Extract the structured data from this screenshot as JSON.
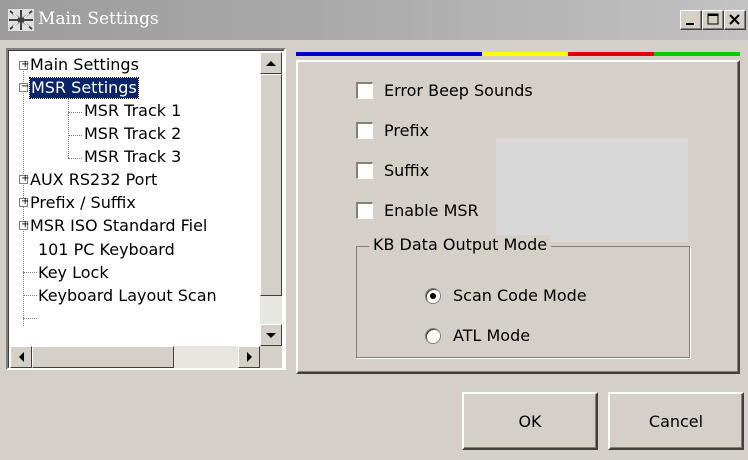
{
  "window": {
    "title": "Main Settings"
  },
  "tree": {
    "items": [
      {
        "label": "Main Settings",
        "expander": "+"
      },
      {
        "label": "MSR Settings",
        "expander": "−"
      },
      {
        "label": "MSR Track 1"
      },
      {
        "label": "MSR Track 2"
      },
      {
        "label": "MSR Track 3"
      },
      {
        "label": "AUX RS232 Port",
        "expander": "+"
      },
      {
        "label": "Prefix / Suffix",
        "expander": "+"
      },
      {
        "label": "MSR ISO Standard Fiel",
        "expander": "+"
      },
      {
        "label": "101 PC Keyboard"
      },
      {
        "label": "Key Lock"
      },
      {
        "label": "Keyboard Layout Scan"
      }
    ]
  },
  "settings": {
    "checkboxes": [
      {
        "label": "Error Beep Sounds",
        "checked": false
      },
      {
        "label": "Prefix",
        "checked": false
      },
      {
        "label": "Suffix",
        "checked": false
      },
      {
        "label": "Enable MSR",
        "checked": false
      }
    ],
    "output_mode": {
      "label": "KB Data Output Mode",
      "options": [
        {
          "label": "Scan Code Mode",
          "selected": true
        },
        {
          "label": "ATL Mode",
          "selected": false
        }
      ]
    }
  },
  "buttons": {
    "ok": "OK",
    "cancel": "Cancel"
  },
  "colors": {
    "strip": [
      "#0000cc",
      "#ffff00",
      "#dd0000",
      "#00cc00"
    ],
    "selection": "#0a246a"
  }
}
